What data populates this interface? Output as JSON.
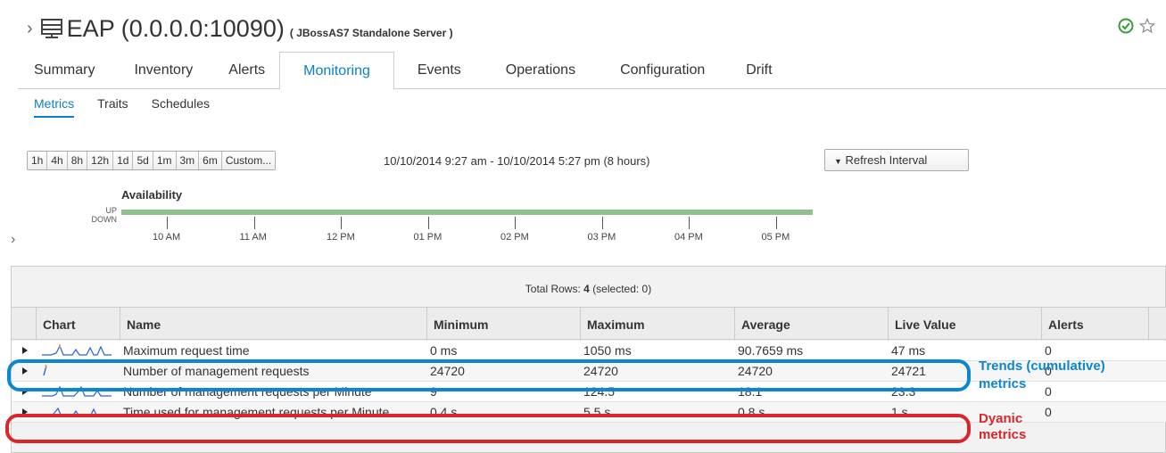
{
  "header": {
    "resource_name": "EAP (0.0.0.0:10090)",
    "resource_type": "( JBossAS7 Standalone Server )",
    "icons": [
      "chevron-right-icon",
      "server-icon",
      "check-circle-icon",
      "star-icon"
    ],
    "status_color": "#3a9b3a"
  },
  "main_tabs": [
    {
      "label": "Summary"
    },
    {
      "label": "Inventory"
    },
    {
      "label": "Alerts"
    },
    {
      "label": "Monitoring",
      "active": true
    },
    {
      "label": "Events"
    },
    {
      "label": "Operations"
    },
    {
      "label": "Configuration"
    },
    {
      "label": "Drift"
    }
  ],
  "sub_tabs": [
    {
      "label": "Metrics",
      "active": true
    },
    {
      "label": "Traits"
    },
    {
      "label": "Schedules"
    }
  ],
  "ranges": [
    "1h",
    "4h",
    "8h",
    "12h",
    "1d",
    "5d",
    "1m",
    "3m",
    "6m",
    "Custom..."
  ],
  "range_text": "10/10/2014 9:27 am - 10/10/2014 5:27 pm (8 hours)",
  "refresh_label": "Refresh Interval",
  "availability": {
    "title": "Availability",
    "up_label": "UP",
    "down_label": "DOWN",
    "ticks": [
      "10 AM",
      "11 AM",
      "12 PM",
      "01 PM",
      "02 PM",
      "03 PM",
      "04 PM",
      "05 PM"
    ],
    "state": "UP",
    "color": "#8fc18f"
  },
  "table": {
    "total_rows_label": "Total Rows:",
    "total_rows_value": "4",
    "selected_text": "(selected: 0)",
    "columns": [
      "Chart",
      "Name",
      "Minimum",
      "Maximum",
      "Average",
      "Live Value",
      "Alerts"
    ],
    "rows": [
      {
        "name": "Maximum request time",
        "min": "0 ms",
        "max": "1050 ms",
        "avg": "90.7659 ms",
        "live": "47 ms",
        "alerts": "0"
      },
      {
        "name": "Number of management requests",
        "min": "24720",
        "max": "24720",
        "avg": "24720",
        "live": "24721",
        "alerts": "0"
      },
      {
        "name": "Number of management requests per Minute",
        "min": "9",
        "max": "124.5",
        "avg": "18.1",
        "live": "23.3",
        "alerts": "0"
      },
      {
        "name": "Time used for management requests per Minute",
        "min": "0.4 s",
        "max": "5.5 s",
        "avg": "0.8 s",
        "live": "1 s",
        "alerts": "0"
      }
    ]
  },
  "annotations": {
    "blue_line1": "Trends (cumulative)",
    "blue_line2": "metrics",
    "red_line1": "Dyanic",
    "red_line2": "metrics",
    "blue_color": "#0b86d0",
    "red_color": "#d9262b"
  }
}
